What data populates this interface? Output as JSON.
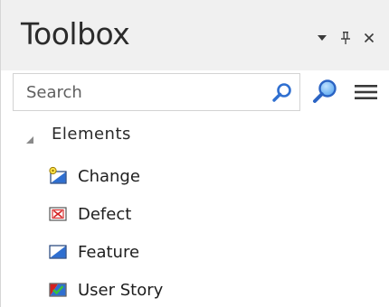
{
  "panel": {
    "title": "Toolbox",
    "controls": [
      {
        "name": "dropdown-arrow-icon"
      },
      {
        "name": "pin-icon"
      },
      {
        "name": "close-icon"
      }
    ]
  },
  "search": {
    "placeholder": "Search",
    "value": ""
  },
  "tree": {
    "group_label": "Elements",
    "expanded": true,
    "items": [
      {
        "label": "Change",
        "icon": "change-icon"
      },
      {
        "label": "Defect",
        "icon": "defect-icon"
      },
      {
        "label": "Feature",
        "icon": "feature-icon"
      },
      {
        "label": "User Story",
        "icon": "user-story-icon"
      }
    ]
  },
  "colors": {
    "header_bg": "#f0f0f0",
    "accent_blue": "#2f6fd0",
    "defect_red": "#d42020",
    "story_green": "#2e9a2e"
  }
}
